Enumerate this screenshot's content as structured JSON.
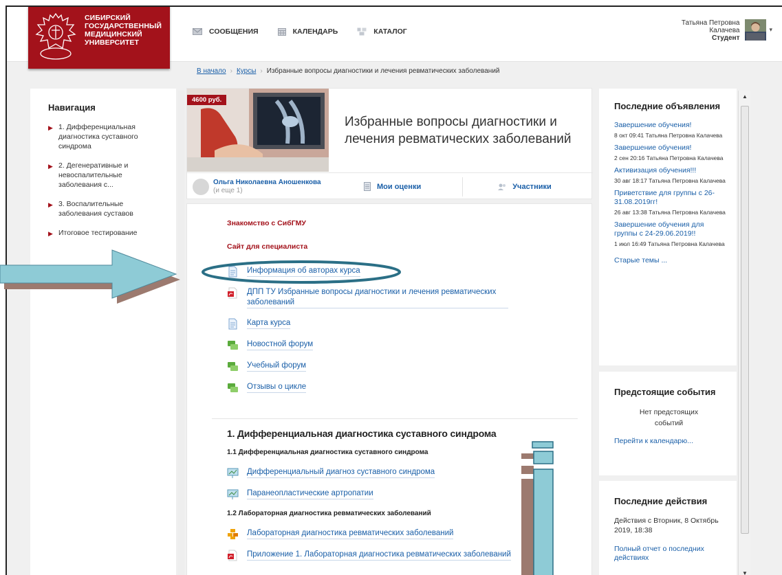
{
  "logo": {
    "lines": [
      "СИБИРСКИЙ",
      "ГОСУДАРСТВЕННЫЙ",
      "МЕДИЦИНСКИЙ",
      "УНИВЕРСИТЕТ"
    ]
  },
  "topnav": [
    {
      "label": "СООБЩЕНИЯ",
      "icon": "envelope-icon"
    },
    {
      "label": "КАЛЕНДАРЬ",
      "icon": "calendar-icon"
    },
    {
      "label": "КАТАЛОГ",
      "icon": "catalog-icon"
    }
  ],
  "user": {
    "name1": "Татьяна Петровна",
    "name2": "Калачева",
    "role": "Студент"
  },
  "breadcrumb": {
    "home": "В начало",
    "courses": "Курсы",
    "current": "Избранные вопросы диагностики и лечения ревматических заболеваний"
  },
  "nav": {
    "title": "Навигация",
    "items": [
      "1. Дифференциальная диагностика суставного синдрома",
      "2. Дегенеративные и невоспалительные заболевания с...",
      "3. Воспалительные заболевания суставов",
      "Итоговое тестирование"
    ]
  },
  "course": {
    "price": "4600 руб.",
    "title": "Избранные вопросы диагностики и лечения ревматических заболеваний",
    "teacher": "Ольга Николаевна Аношенкова",
    "more": "(и еще 1)",
    "grades": "Мои оценки",
    "participants": "Участники"
  },
  "intro": {
    "link1": "Знакомство с СибГМУ",
    "link2": "Сайт для специалиста",
    "activities": [
      "Информация об авторах курса",
      "ДПП ТУ Избранные вопросы диагностики и лечения ревматических заболеваний",
      "Карта курса",
      "Новостной форум",
      "Учебный форум",
      "Отзывы о цикле"
    ]
  },
  "section1": {
    "title": "1. Дифференциальная диагностика суставного синдрома",
    "sub1": "1.1 Дифференциальная диагностика суставного синдрома",
    "act1": "Дифференциальный диагноз суставного синдрома",
    "act2": "Паранеопластические артропатии",
    "sub2": "1.2 Лабораторная диагностика ревматических заболеваний",
    "act3": "Лабораторная диагностика ревматических заболеваний",
    "act4": "Приложение 1. Лабораторная диагностика ревматических заболеваний"
  },
  "announcements": {
    "title": "Последние объявления",
    "items": [
      {
        "title": "Завершение обучения!",
        "date": "8 окт 09:41 Татьяна Петровна Калачева"
      },
      {
        "title": "Завершение обучения!",
        "date": "2 сен 20:16 Татьяна Петровна Калачева"
      },
      {
        "title": "Активизация обучения!!!",
        "date": "30 авг 18:17 Татьяна Петровна Калачева"
      },
      {
        "title": "Приветствие для группы с 26-31.08.2019гг!",
        "date": "26 авг 13:38 Татьяна Петровна Калачева"
      },
      {
        "title": "Завершение обучения для группы с 24-29.06.2019!!",
        "date": "1 июл 16:49 Татьяна Петровна Калачева"
      }
    ],
    "old": "Старые темы ..."
  },
  "events": {
    "title": "Предстоящие события",
    "empty": "Нет предстоящих событий",
    "link": "Перейти к календарю..."
  },
  "recent": {
    "title": "Последние действия",
    "since": "Действия с Вторник, 8 Октябрь 2019, 18:38",
    "link": "Полный отчет о последних действиях"
  },
  "colors": {
    "brand": "#a3121b",
    "link": "#1a5fa8",
    "annotation": "#8ecbd6"
  }
}
